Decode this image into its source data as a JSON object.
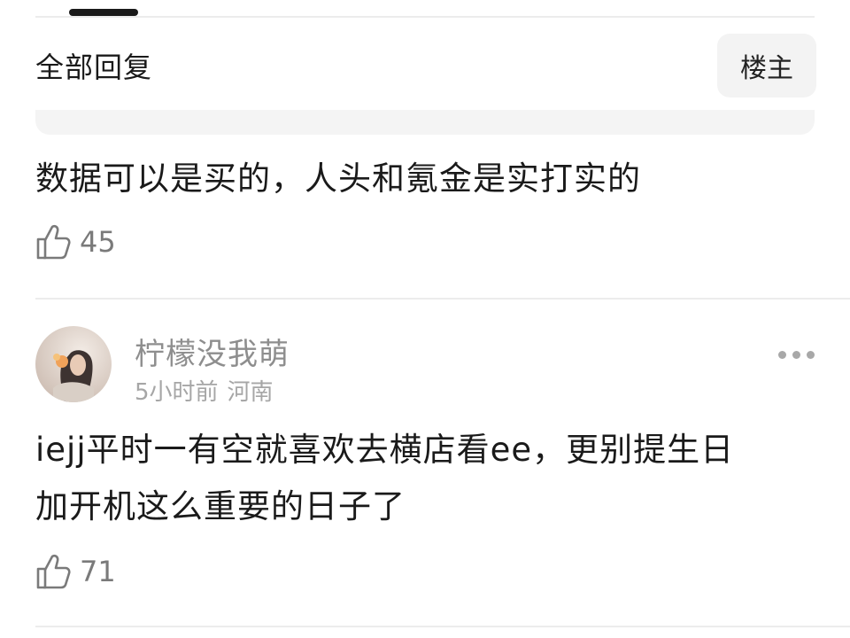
{
  "header": {
    "title": "全部回复",
    "op_filter_label": "楼主"
  },
  "comments": [
    {
      "text": "数据可以是买的，人头和氪金是实打实的",
      "likes": "45"
    },
    {
      "username": "柠檬没我萌",
      "time": "5小时前",
      "location": "河南",
      "text_line1": "iejj平时一有空就喜欢去横店看ee，更别提生日",
      "text_line2": "加开机这么重要的日子了",
      "likes": "71"
    }
  ]
}
